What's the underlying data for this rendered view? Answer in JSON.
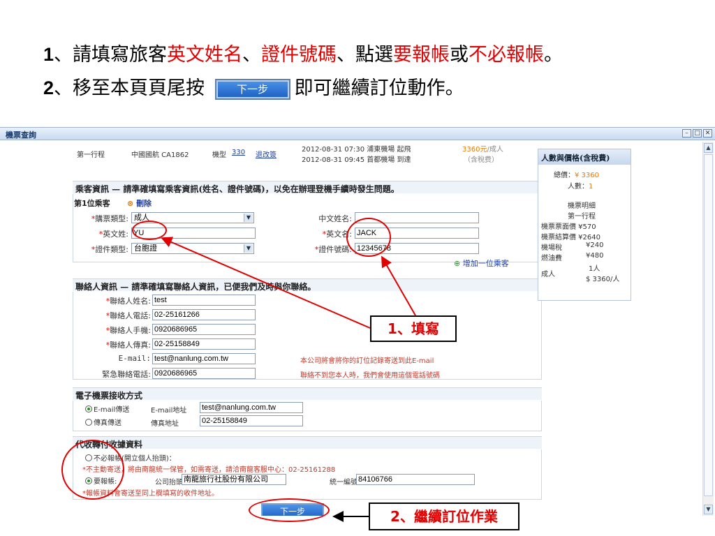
{
  "instructions": {
    "line1": {
      "num": "1",
      "sep": "、",
      "t1": "請填寫旅客",
      "r1": "英文姓名",
      "t2": "、",
      "r2": "證件號碼",
      "t3": "、點選",
      "r3": "要報帳",
      "t4": "或",
      "r4": "不必報帳",
      "t5": "。"
    },
    "line2": {
      "num": "2",
      "sep": "、",
      "t1": "移至本頁頁尾按",
      "btn": "下一步",
      "t2": "即可繼續訂位動作。"
    }
  },
  "window": {
    "title": "機票查詢",
    "controls": [
      "–",
      "□",
      "✕"
    ]
  },
  "flight": {
    "segment": "第一行程",
    "airline": "中國國航 CA1862",
    "model_label": "機型",
    "model": "330",
    "refund": "退改簽",
    "depart": "2012-08-31 07:30  浦東機場 起飛",
    "arrive": "2012-08-31 09:45  首都機場 到達",
    "price": "3360元",
    "per": "/成人",
    "tax": "（含稅费）"
  },
  "passenger": {
    "section": "乘客資訊 — 請準確填寫乘客資訊(姓名、證件號碼)，以免在辦理登機手續時發生問題。",
    "first": "第1位乘客",
    "delete": "刪除",
    "ticket_type_label": "購票類型:",
    "ticket_type": "成人",
    "cn_name_label": "中文姓名:",
    "cn_name": "",
    "last_name_label": "英文姓:",
    "last_name": "YU",
    "first_name_label": "英文名:",
    "first_name": "JACK",
    "id_type_label": "證件類型:",
    "id_type": "台胞證",
    "id_no_label": "證件號碼:",
    "id_no": "12345678",
    "add": "增加一位乘客"
  },
  "contact": {
    "section": "聯絡人資訊 — 請準確填寫聯絡人資訊，已便我們及時與你聯絡。",
    "name_label": "聯絡人姓名:",
    "name": "test",
    "phone_label": "聯絡人電話:",
    "phone": "02-25161266",
    "mobile_label": "聯絡人手機:",
    "mobile": "0920686965",
    "fax_label": "聯絡人傳真:",
    "fax": "02-25158849",
    "email_label": "E-mail:",
    "email": "test@nanlung.com.tw",
    "emergency_label": "緊急聯絡電話:",
    "emergency": "0920686965",
    "note1": "本公司將會將你的訂位記錄寄送到此E-mail",
    "note2": "聯絡不到您本人時，我們會使用這個電話號碼"
  },
  "eticket": {
    "section": "電子機票接收方式",
    "opt1": "E-mail傳送",
    "opt1_field": "E-mail地址",
    "opt1_value": "test@nanlung.com.tw",
    "opt2": "傳真傳送",
    "opt2_field": "傳真地址",
    "opt2_value": "02-25158849"
  },
  "invoice": {
    "section": "代收轉付收據資料",
    "opt1": "不必報帳(開立個人抬頭)：",
    "note1": "*不主動寄送，將由南龍統一保管，如需寄送，請洽南龍客服中心：02-25161288",
    "opt2": "要報帳:",
    "company_label": "公司抬頭",
    "company": "南龍旅行社股份有限公司",
    "tax_id_label": "統一編號",
    "tax_id": "84106766",
    "note2": "*報帳資料會寄送至同上欄填寫的收件地址。"
  },
  "next_button": "下一步",
  "sidebar": {
    "title": "人數與價格(含稅費)",
    "total_label": "總價：",
    "total": "¥ 3360",
    "count_label": "人數：",
    "count": "1",
    "detail": "機票明細",
    "segment": "第一行程",
    "face": "機票票面價 ¥570",
    "settle": "機票結算價 ¥2640",
    "airport": "機場稅",
    "airport_v": "¥240",
    "fuel": "燃油費",
    "fuel_v": "¥480",
    "adult": "成人",
    "adult_n": "1人",
    "adult_v": "$ 3360/人"
  },
  "callouts": {
    "fill": "1、填寫",
    "continue": "2、繼續訂位作業"
  },
  "colors": {
    "highlight": "#e00000",
    "button": "#1b5fc2"
  }
}
